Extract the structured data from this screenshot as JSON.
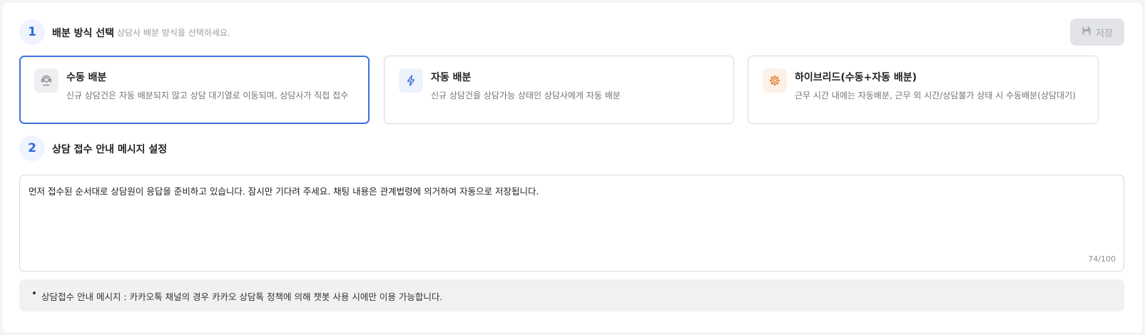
{
  "section1": {
    "number": "1",
    "title": "배분 방식 선택",
    "description": "상담사 배분 방식을 선택하세요.",
    "save_label": "저장",
    "save_icon": "save-icon"
  },
  "cards": [
    {
      "title": "수동 배분",
      "description": "신규 상담건은 자동 배분되지 않고 상담 대기열로 이동되며, 상담사가 직접 접수",
      "icon": "agent-headset-icon",
      "selected": true
    },
    {
      "title": "자동 배분",
      "description": "신규 상담건을 상담가능 상태인 상담사에게 자동 배분",
      "icon": "lightning-icon",
      "selected": false
    },
    {
      "title": "하이브리드(수동+자동 배분)",
      "description": "근무 시간 내에는 자동배분, 근무 외 시간/상담불가 상태 시 수동배분(상담대기)",
      "icon": "gear-icon",
      "selected": false
    }
  ],
  "section2": {
    "number": "2",
    "title": "상담 접수 안내 메시지 설정",
    "message_value": "먼저 접수된 순서대로 상담원이 응답을 준비하고 있습니다. 잠시만 기다려 주세요. 채팅 내용은 관계법령에 의거하여 자동으로 저장됩니다.",
    "char_count": "74/100",
    "notice": "상담접수 안내 메시지 : 카카오톡 채널의 경우 카카오 상담톡 정책에 의해 챗봇 사용 시에만 이용 가능합니다."
  },
  "colors": {
    "accent": "#3d73dd",
    "badge_bg": "#eef3fd",
    "disabled_button": "#e3e4e7",
    "manual_icon_bg": "#efeff1",
    "auto_icon_bg": "#eef2fd",
    "hybrid_icon_bg": "#fdf1e7",
    "hybrid_icon": "#e07a2a"
  }
}
